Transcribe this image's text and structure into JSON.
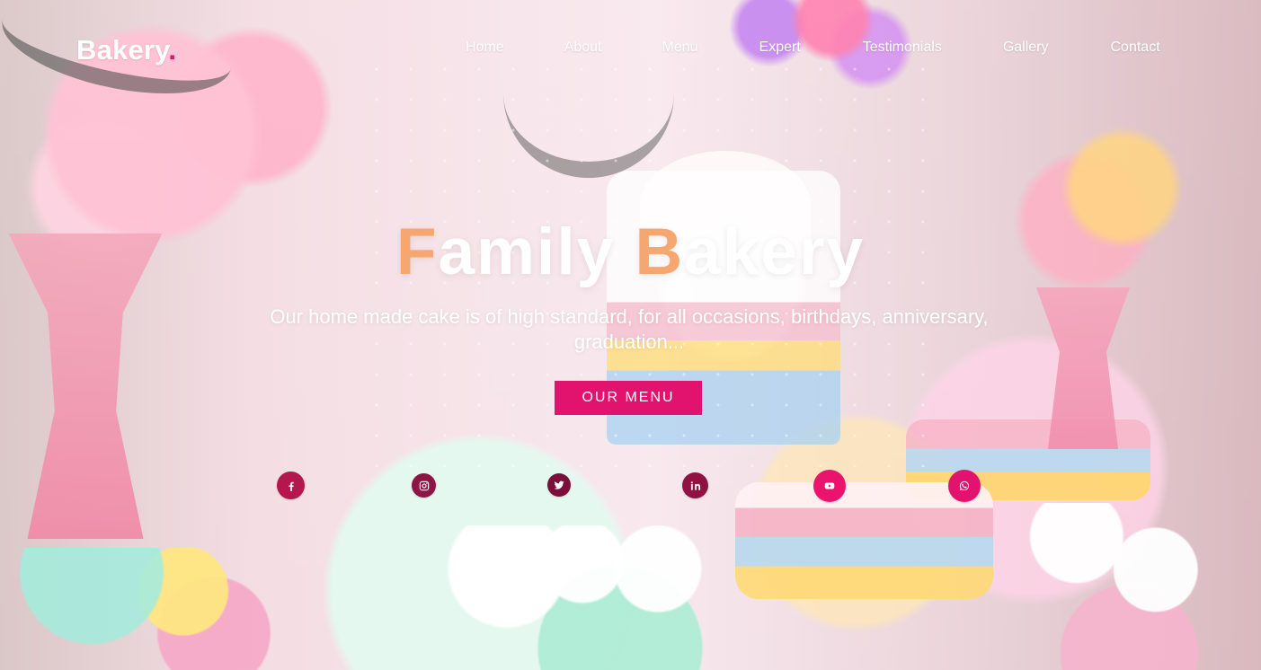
{
  "brand": {
    "name": "Bakery",
    "dot": ".",
    "dot_color": "#e2136e"
  },
  "nav": {
    "items": [
      {
        "label": "Home"
      },
      {
        "label": "About"
      },
      {
        "label": "Menu"
      },
      {
        "label": "Expert"
      },
      {
        "label": "Testimonials"
      },
      {
        "label": "Gallery"
      },
      {
        "label": "Contact"
      }
    ]
  },
  "hero": {
    "title": {
      "word1_first": "F",
      "word1_rest": "amily",
      "space": " ",
      "word2_first": "B",
      "word2_rest": "akery"
    },
    "subtitle": "Our home made cake is of high standard, for all occasions, birthdays, anniversary, graduation...",
    "cta": "OUR MENU",
    "accent_color": "#f6a66f",
    "button_color": "#e2136e"
  },
  "social": [
    {
      "icon": "facebook-icon"
    },
    {
      "icon": "instagram-icon"
    },
    {
      "icon": "twitter-icon"
    },
    {
      "icon": "linkedin-icon"
    },
    {
      "icon": "youtube-icon"
    },
    {
      "icon": "whatsapp-icon"
    }
  ]
}
